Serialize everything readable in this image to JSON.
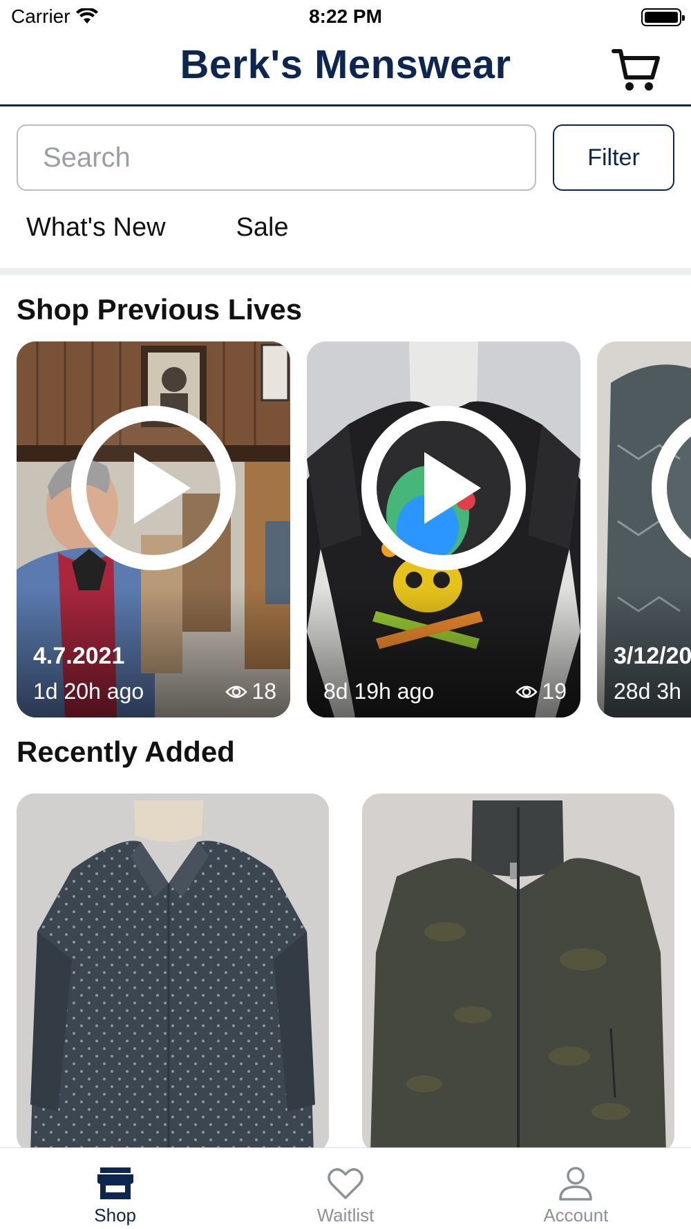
{
  "status_bar": {
    "carrier": "Carrier",
    "time": "8:22 PM"
  },
  "header": {
    "title": "Berk's Menswear",
    "cart_icon": "cart-icon"
  },
  "search": {
    "placeholder": "Search",
    "value": "",
    "filter_label": "Filter"
  },
  "quick_links": [
    "What's New",
    "Sale"
  ],
  "previous_lives": {
    "title": "Shop Previous Lives",
    "items": [
      {
        "date": "4.7.2021",
        "ago": "1d 20h ago",
        "views": "18"
      },
      {
        "date": "",
        "ago": "8d 19h ago",
        "views": "19"
      },
      {
        "date": "3/12/20",
        "ago": "28d 3h",
        "views": ""
      }
    ]
  },
  "recently_added": {
    "title": "Recently Added",
    "items": [
      {
        "kind": "dotted dress shirt"
      },
      {
        "kind": "full-zip jacket"
      }
    ]
  },
  "tab_bar": {
    "tabs": [
      {
        "label": "Shop",
        "icon": "store-icon",
        "active": true
      },
      {
        "label": "Waitlist",
        "icon": "heart-icon",
        "active": false
      },
      {
        "label": "Account",
        "icon": "person-icon",
        "active": false
      }
    ]
  },
  "colors": {
    "brand": "#0d2650",
    "inactive": "#8c9097",
    "divider": "#eceef0"
  }
}
